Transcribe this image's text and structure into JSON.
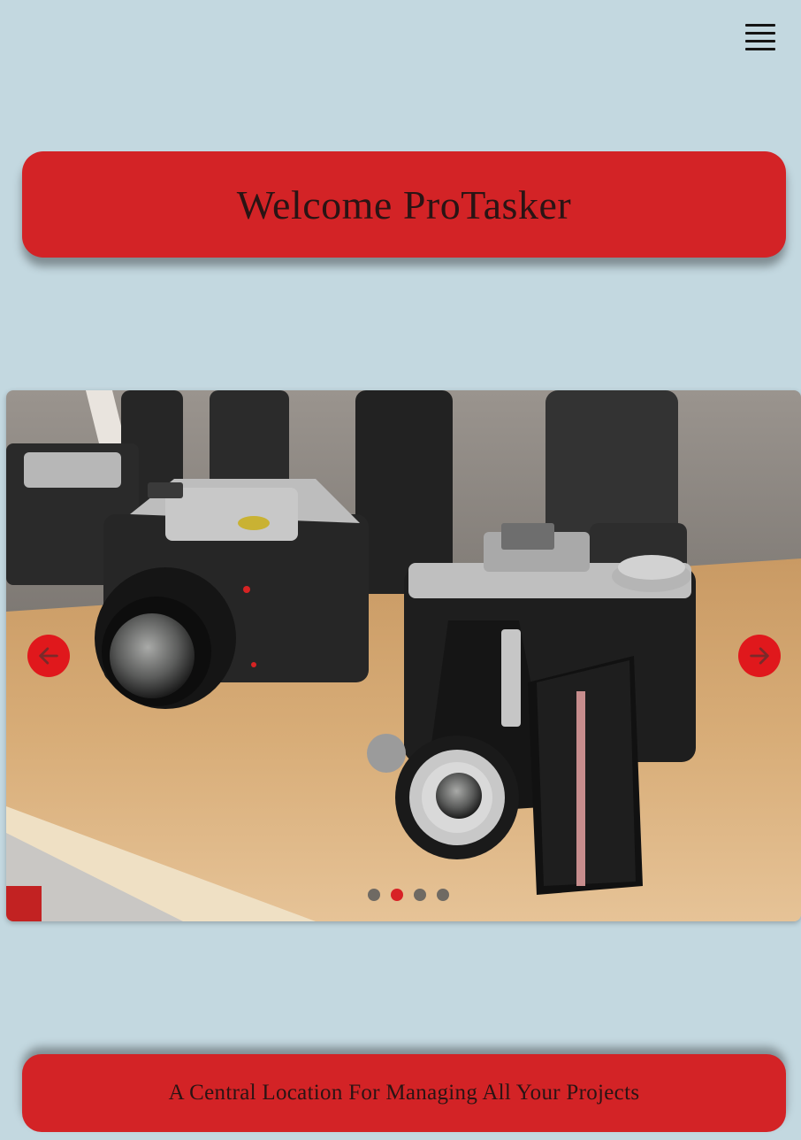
{
  "header": {
    "menu_icon": "hamburger-menu-icon"
  },
  "welcome": {
    "title": "Welcome ProTasker"
  },
  "carousel": {
    "image_subject": "vintage cameras on a wooden shelf",
    "prev_icon": "arrow-left-icon",
    "next_icon": "arrow-right-icon",
    "slide_count": 4,
    "active_slide": 2
  },
  "tagline": {
    "text": "A Central Location For Managing All Your Projects"
  },
  "colors": {
    "background": "#c3d8e0",
    "accent": "#d32326",
    "text": "#2a1414"
  }
}
